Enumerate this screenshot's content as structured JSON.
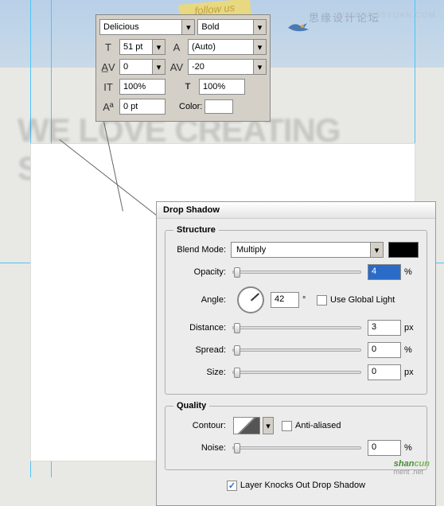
{
  "ribbon_text": "follow us",
  "watermark_cn": "思缘设计论坛",
  "watermark_url": "WWW.MISSYUAN.COM",
  "char_panel": {
    "font_family": "Delicious",
    "font_style": "Bold",
    "font_size": "51 pt",
    "leading": "(Auto)",
    "kerning": "0",
    "tracking": "-20",
    "vscale": "100%",
    "hscale": "100%",
    "baseline": "0 pt",
    "color_label": "Color:"
  },
  "headline": "WE LOVE CREATING STUFF",
  "drop_shadow": {
    "panel_title": "Drop Shadow",
    "structure_legend": "Structure",
    "blend_mode_label": "Blend Mode:",
    "blend_mode_value": "Multiply",
    "opacity_label": "Opacity:",
    "opacity_value": "4",
    "angle_label": "Angle:",
    "angle_value": "42",
    "angle_unit": "°",
    "use_global_label": "Use Global Light",
    "distance_label": "Distance:",
    "distance_value": "3",
    "spread_label": "Spread:",
    "spread_value": "0",
    "size_label": "Size:",
    "size_value": "0",
    "quality_legend": "Quality",
    "contour_label": "Contour:",
    "antialiased_label": "Anti-aliased",
    "noise_label": "Noise:",
    "noise_value": "0",
    "knockout_label": "Layer Knocks Out Drop Shadow",
    "px": "px",
    "pct": "%"
  },
  "logo": {
    "part1": "shan",
    "part2": "cun",
    "sub": "ment .net"
  }
}
